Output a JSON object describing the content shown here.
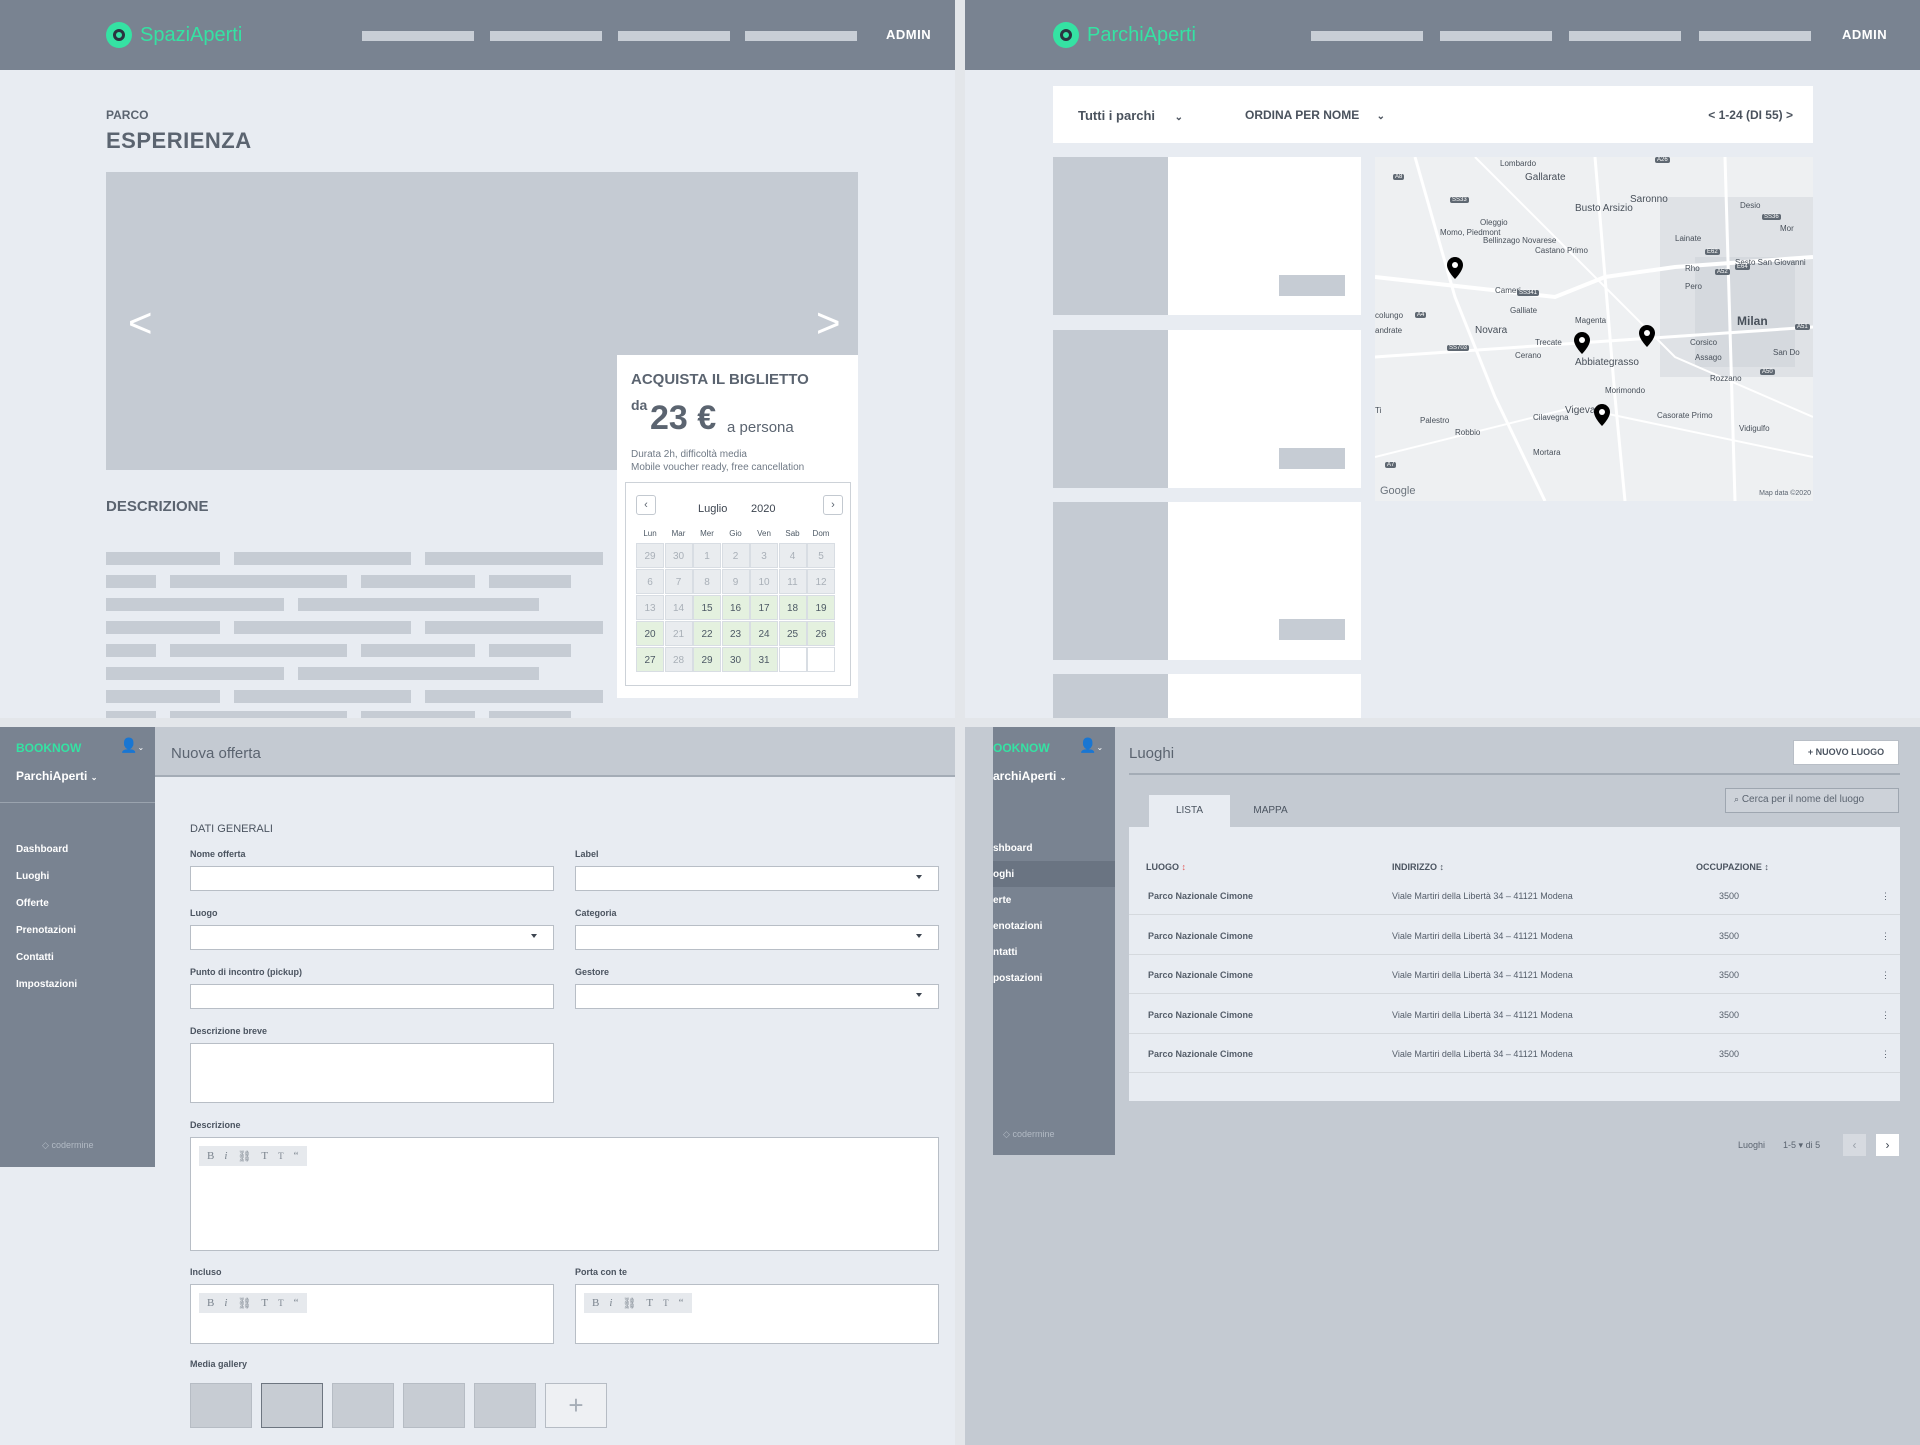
{
  "panel1": {
    "brand": "SpaziAperti",
    "admin": "ADMIN",
    "kicker": "PARCO",
    "title": "ESPERIENZA",
    "description_heading": "DESCRIZIONE",
    "ticket": {
      "heading": "ACQUISTA IL BIGLIETTO",
      "prefix": "da",
      "price": "23 €",
      "suffix": "a persona",
      "line1": "Durata 2h, difficoltà media",
      "line2": "Mobile voucher ready, free cancellation"
    },
    "calendar": {
      "month": "Luglio",
      "year": "2020",
      "weekdays": [
        "Lun",
        "Mar",
        "Mer",
        "Gio",
        "Ven",
        "Sab",
        "Dom"
      ],
      "rows": [
        [
          "29",
          "30",
          "1",
          "2",
          "3",
          "4",
          "5"
        ],
        [
          "6",
          "7",
          "8",
          "9",
          "10",
          "11",
          "12"
        ],
        [
          "13",
          "14",
          "15",
          "16",
          "17",
          "18",
          "19"
        ],
        [
          "20",
          "21",
          "22",
          "23",
          "24",
          "25",
          "26"
        ],
        [
          "27",
          "28",
          "29",
          "30",
          "31",
          "",
          ""
        ]
      ]
    }
  },
  "panel2": {
    "brand": "ParchiAperti",
    "admin": "ADMIN",
    "filter": "Tutti i parchi",
    "sort": "ORDINA PER NOME",
    "pagination": "< 1-24 (DI 55) >",
    "map": {
      "places": [
        "Lombardo",
        "Gallarate",
        "Saronno",
        "Desio",
        "Busto Arsizio",
        "Oleggio",
        "Momo, Piedmont",
        "Bellinzago Novarese",
        "Castano Primo",
        "Lainate",
        "Rho",
        "Sesto San Giovanni",
        "Cameri",
        "Galliate",
        "Pero",
        "Milan",
        "Novara",
        "Trecate",
        "Magenta",
        "Corsico",
        "Assago",
        "Cerano",
        "Abbiategrasso",
        "Rozzano",
        "Morimondo",
        "Vigevano",
        "Palestro",
        "Robbio",
        "Cilavegna",
        "Casorate Primo",
        "Vidigulfo",
        "Mortara",
        "San Do",
        "Mor",
        "colungo",
        "andrate",
        "Ti"
      ],
      "roads": [
        "A26",
        "A8",
        "SS33",
        "SS36",
        "A52",
        "E62",
        "E64",
        "SS341",
        "A4",
        "SS703",
        "A51",
        "A50",
        "A7"
      ],
      "google": "Google",
      "attribution": "Map data ©2020"
    }
  },
  "panel3": {
    "brand": "BOOKNOW",
    "org": "ParchiAperti",
    "nav": [
      "Dashboard",
      "Luoghi",
      "Offerte",
      "Prenotazioni",
      "Contatti",
      "Impostazioni"
    ],
    "footer": "codermine",
    "page_title": "Nuova offerta",
    "section": "DATI GENERALI",
    "labels": {
      "nome": "Nome offerta",
      "label": "Label",
      "luogo": "Luogo",
      "categoria": "Categoria",
      "punto": "Punto di incontro (pickup)",
      "gestore": "Gestore",
      "breve": "Descrizione breve",
      "descrizione": "Descrizione",
      "incluso": "Incluso",
      "porta": "Porta con te",
      "media": "Media gallery"
    },
    "toolbar": [
      "B",
      "i",
      "⛓",
      "T",
      "T",
      "“"
    ],
    "add": "+"
  },
  "panel4": {
    "brand": "OOKNOW",
    "org": "archiAperti",
    "nav": [
      "shboard",
      "oghi",
      "erte",
      "enotazioni",
      "ntatti",
      "postazioni"
    ],
    "footer": "codermine",
    "page_title": "Luoghi",
    "new_button": "+ NUOVO LUOGO",
    "search_placeholder": "Cerca per il nome  del luogo",
    "tabs": [
      "LISTA",
      "MAPPA"
    ],
    "columns": [
      "LUOGO",
      "INDIRIZZO",
      "OCCUPAZIONE"
    ],
    "rows": [
      {
        "name": "Parco Nazionale Cimone",
        "address": "Viale Martiri della Libertà 34 – 41121 Modena",
        "occupancy": "3500"
      },
      {
        "name": "Parco Nazionale Cimone",
        "address": "Viale Martiri della Libertà 34 – 41121 Modena",
        "occupancy": "3500"
      },
      {
        "name": "Parco Nazionale Cimone",
        "address": "Viale Martiri della Libertà 34 – 41121 Modena",
        "occupancy": "3500"
      },
      {
        "name": "Parco Nazionale Cimone",
        "address": "Viale Martiri della Libertà 34 – 41121 Modena",
        "occupancy": "3500"
      },
      {
        "name": "Parco Nazionale Cimone",
        "address": "Viale Martiri della Libertà 34 – 41121 Modena",
        "occupancy": "3500"
      }
    ],
    "footer_label": "Luoghi",
    "footer_range": "1-5",
    "footer_of": "di 5"
  }
}
